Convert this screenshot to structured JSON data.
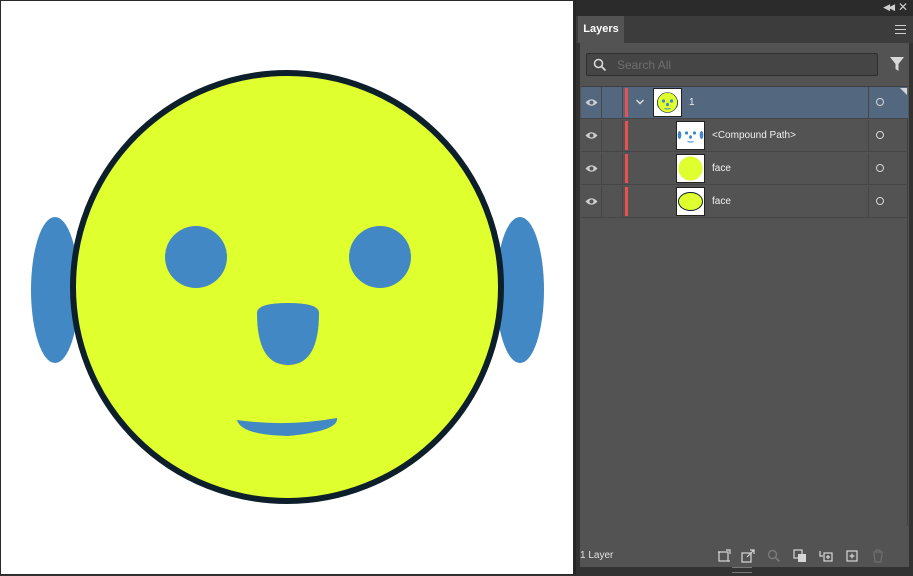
{
  "canvas": {
    "artwork": {
      "face_fill": "#dfff2e",
      "face_stroke": "#0e1f2c",
      "feature_fill": "#4288c4",
      "background": "#ffffff"
    }
  },
  "panel": {
    "tab_label": "Layers",
    "search": {
      "placeholder": "Search All",
      "value": ""
    },
    "layers": [
      {
        "label": "1",
        "selected": true,
        "expanded": true,
        "color": "#e8514f"
      },
      {
        "label": "<Compound Path>",
        "selected": false,
        "color": "#e8514f"
      },
      {
        "label": "face",
        "selected": false,
        "color": "#e8514f"
      },
      {
        "label": "face",
        "selected": false,
        "color": "#e8514f"
      }
    ],
    "status": {
      "layer_count_label": "1 Layer"
    },
    "toolbar_icons": [
      "collect-for-export-icon",
      "export-icon",
      "locate-object-icon",
      "make-clipping-mask-icon",
      "create-new-sublayer-icon",
      "create-new-layer-icon",
      "delete-icon"
    ]
  },
  "colors": {
    "panel_bg": "#535353",
    "selection": "#53687f",
    "layer_color": "#e8514f"
  }
}
